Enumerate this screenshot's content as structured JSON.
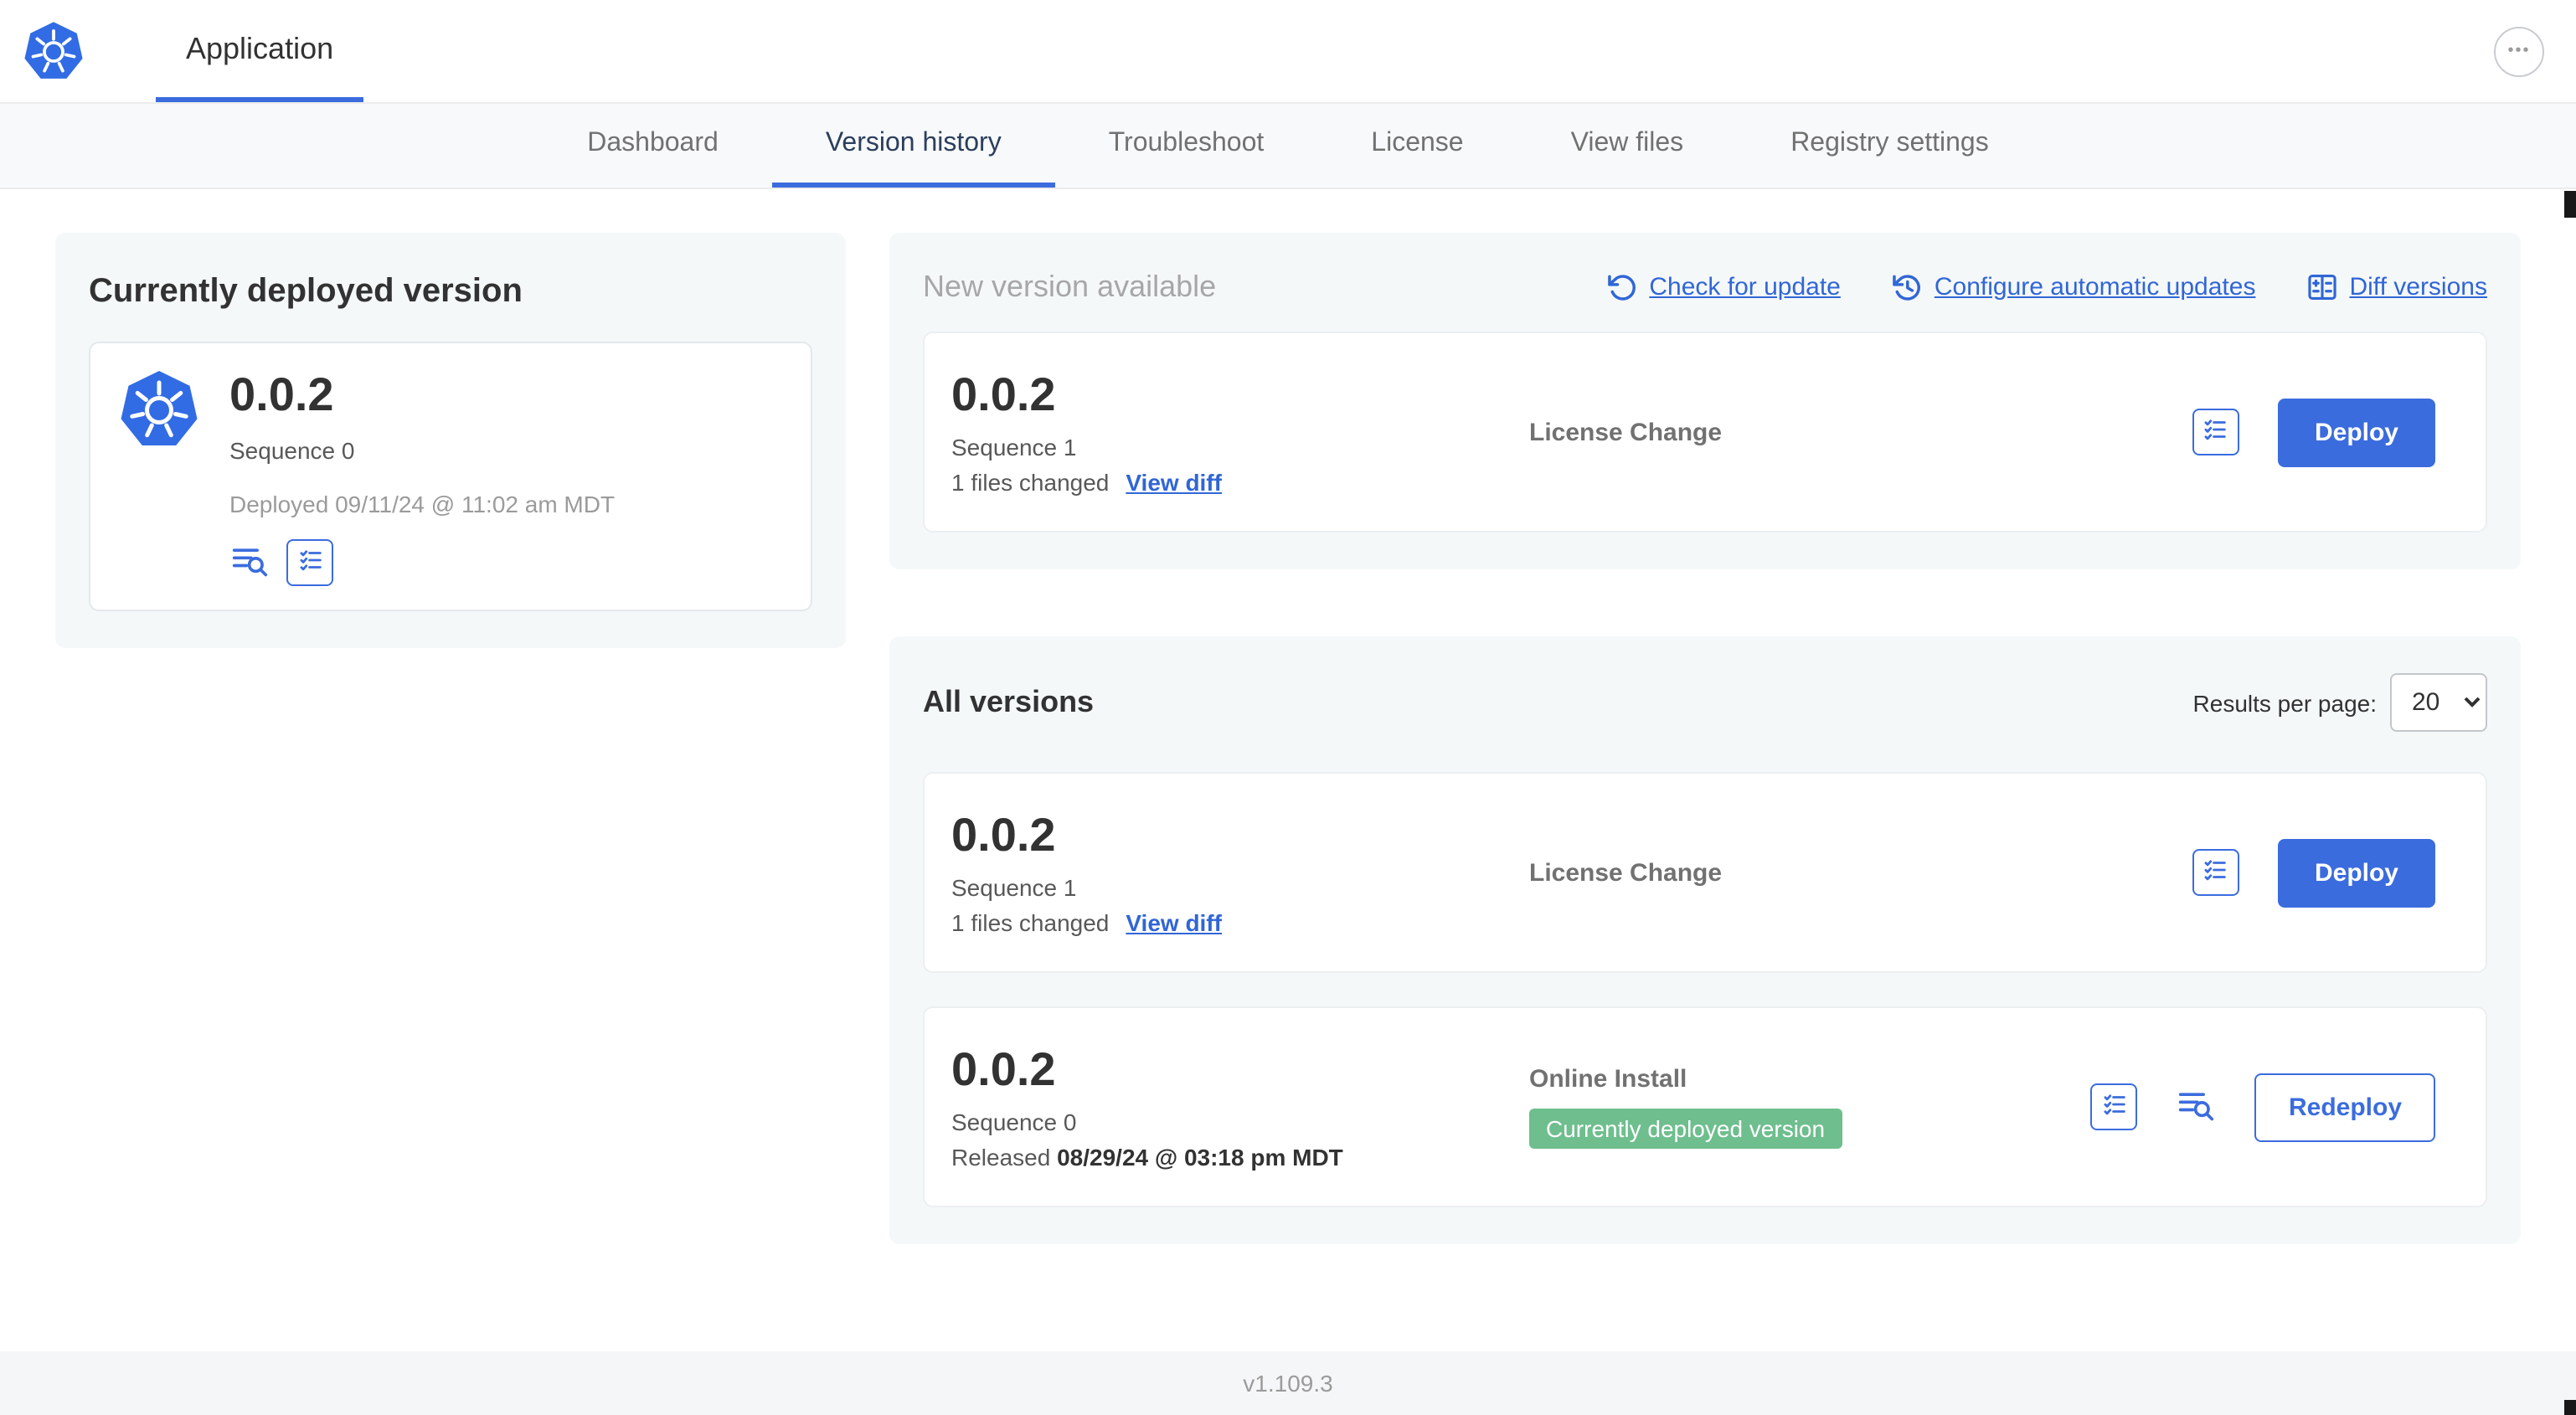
{
  "colors": {
    "primary_blue": "#3b6cde",
    "link_blue": "#3066d6",
    "k8s_blue": "#326ce5",
    "badge_green": "#6fbe8e",
    "panel_gray": "#f5f8f9",
    "muted_gray": "#9b9b9b"
  },
  "icons": {
    "overflow_menu": "•••",
    "select_chevron": "▾"
  },
  "header": {
    "app_label": "Application"
  },
  "nav": {
    "tabs": [
      {
        "label": "Dashboard"
      },
      {
        "label": "Version history"
      },
      {
        "label": "Troubleshoot"
      },
      {
        "label": "License"
      },
      {
        "label": "View files"
      },
      {
        "label": "Registry settings"
      }
    ]
  },
  "current": {
    "title": "Currently deployed version",
    "version": "0.0.2",
    "sequence": "Sequence 0",
    "deployed": "Deployed 09/11/24 @ 11:02 am MDT"
  },
  "new_version": {
    "title": "New version available",
    "check_for_update": "Check for update",
    "configure_automatic_updates": "Configure automatic updates",
    "diff_versions": "Diff versions",
    "release": {
      "version": "0.0.2",
      "sequence": "Sequence 1",
      "files_changed": "1 files changed",
      "view_diff": "View diff",
      "source": "License Change",
      "action": "Deploy"
    }
  },
  "all_versions": {
    "title": "All versions",
    "results_per_page_label": "Results per page:",
    "results_per_page_value": "20",
    "rows": [
      {
        "version": "0.0.2",
        "sequence": "Sequence 1",
        "files_changed": "1 files changed",
        "view_diff": "View diff",
        "source": "License Change",
        "action": "Deploy"
      },
      {
        "version": "0.0.2",
        "sequence": "Sequence 0",
        "released_prefix": "Released",
        "released_date": "08/29/24 @ 03:18 pm MDT",
        "source": "Online Install",
        "badge": "Currently deployed version",
        "action": "Redeploy"
      }
    ]
  },
  "footer": {
    "app_version": "v1.109.3"
  }
}
